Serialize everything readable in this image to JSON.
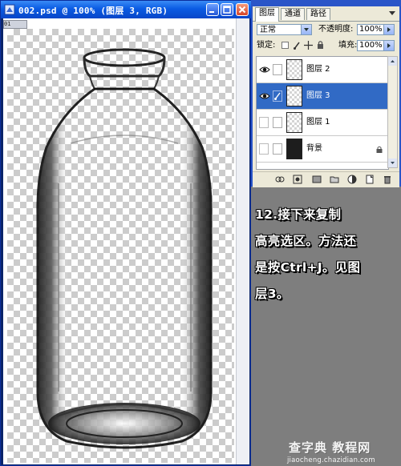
{
  "document_window": {
    "title": "002.psd @ 100% (图层 3, RGB)",
    "ruler_tag": "01",
    "buttons": [
      "minimize",
      "maximize",
      "close"
    ]
  },
  "layers_palette": {
    "tabs": [
      {
        "label": "图层",
        "active": true
      },
      {
        "label": "通道",
        "active": false
      },
      {
        "label": "路径",
        "active": false
      }
    ],
    "blend_mode": "正常",
    "opacity_label": "不透明度:",
    "opacity_value": "100%",
    "lock_label": "锁定:",
    "fill_label": "填充:",
    "fill_value": "100%",
    "layers": [
      {
        "name": "图层 2",
        "visible": true,
        "selected": false,
        "brush": false,
        "locked": false
      },
      {
        "name": "图层 3",
        "visible": true,
        "selected": true,
        "brush": true,
        "locked": false
      },
      {
        "name": "图层 1",
        "visible": false,
        "selected": false,
        "brush": false,
        "locked": false
      },
      {
        "name": "背景",
        "visible": false,
        "selected": false,
        "brush": false,
        "locked": true
      }
    ],
    "bottom_buttons": [
      "link-layers",
      "layer-style",
      "add-mask",
      "new-set",
      "adjustment-layer",
      "new-layer",
      "delete-layer"
    ]
  },
  "annotation": {
    "line1": "12.接下来复制",
    "line2": "高亮选区。方法还",
    "line3": "是按Ctrl+J。见图",
    "line4": "层3。"
  },
  "watermark": {
    "line1": "查字典 教程网",
    "line2": "jiaocheng.chazidian.com"
  },
  "colors": {
    "title_bar": "#0a5be3",
    "selected_layer": "#316ac5",
    "background": "#7e7e7e"
  }
}
